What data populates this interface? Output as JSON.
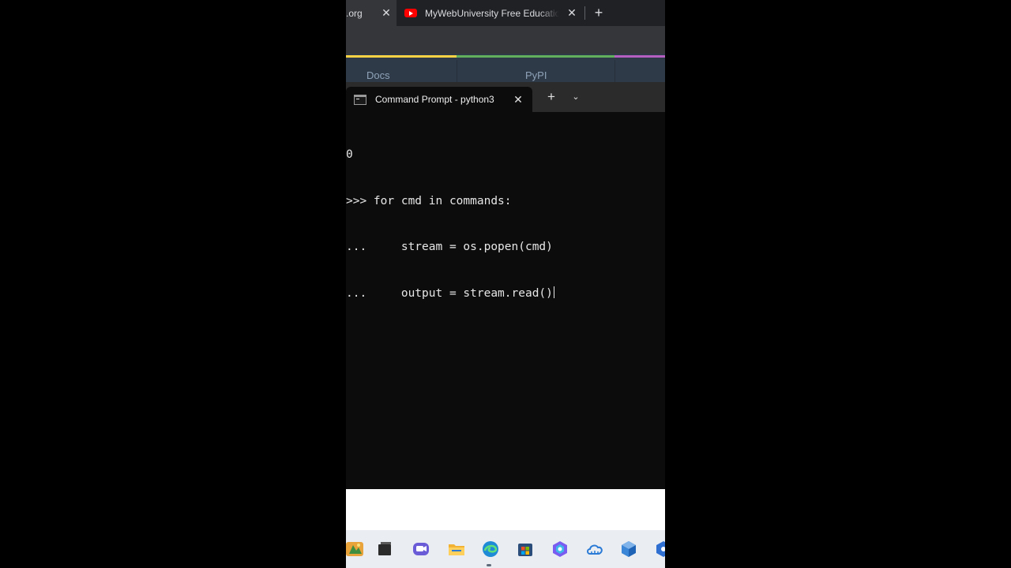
{
  "browser": {
    "tabs": [
      {
        "title": ".org",
        "active": true
      },
      {
        "title": "MyWebUniversity Free Education",
        "active": false
      }
    ]
  },
  "site_nav": {
    "items": [
      "Docs",
      "PyPI"
    ]
  },
  "terminal": {
    "tab_title": "Command Prompt - python3",
    "lines": [
      "0",
      ">>> for cmd in commands:",
      "...     stream = os.popen(cmd)",
      "...     output = stream.read()"
    ]
  },
  "taskbar": {
    "icons": [
      "widgets-icon",
      "task-view-icon",
      "chat-icon",
      "file-explorer-icon",
      "edge-icon",
      "store-icon",
      "copilot-icon",
      "onedrive-icon",
      "virtualbox-icon",
      "app-icon"
    ]
  },
  "colors": {
    "terminal_bg": "#0c0c0c",
    "browser_bg": "#202124",
    "youtube_red": "#ff0000",
    "taskbar_bg": "#eaeef3"
  }
}
